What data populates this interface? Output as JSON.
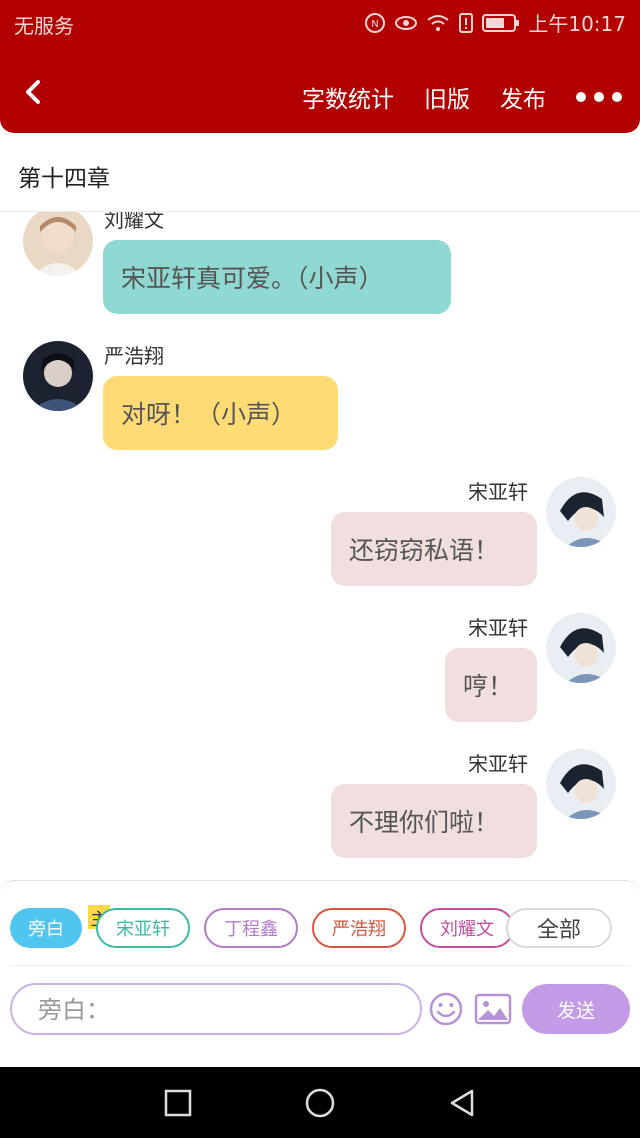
{
  "status": {
    "carrier": "无服务",
    "time": "上午10:17"
  },
  "header": {
    "actions": [
      "字数统计",
      "旧版",
      "发布"
    ],
    "theme_color": "#b20000"
  },
  "chapter": {
    "title": "第十四章"
  },
  "messages": [
    {
      "side": "left",
      "name": "刘耀文",
      "text": "宋亚轩真可爱。（小声）",
      "bubble_color": "#8fd9d2"
    },
    {
      "side": "left",
      "name": "严浩翔",
      "text": "对呀！（小声）",
      "bubble_color": "#fedb75"
    },
    {
      "side": "right",
      "name": "宋亚轩",
      "text": "还窃窃私语！",
      "bubble_color": "#f1dede"
    },
    {
      "side": "right",
      "name": "宋亚轩",
      "text": "哼！",
      "bubble_color": "#f1dede"
    },
    {
      "side": "right",
      "name": "宋亚轩",
      "text": "不理你们啦！",
      "bubble_color": "#f1dede"
    }
  ],
  "composer": {
    "roles": [
      {
        "label": "旁白",
        "color": "#4fc5f0",
        "active": true
      },
      {
        "label": "宋亚轩",
        "color": "#3cb8a6",
        "active": false
      },
      {
        "label": "丁程鑫",
        "color": "#b27acb",
        "active": false
      },
      {
        "label": "严浩翔",
        "color": "#d8553d",
        "active": false
      },
      {
        "label": "刘耀文",
        "color": "#c44e9e",
        "active": false
      },
      {
        "label": "全部",
        "color": "#d9d9d9",
        "active": false
      }
    ],
    "protagonist_mark": "主",
    "input_placeholder": "旁白：",
    "send_label": "发送"
  }
}
